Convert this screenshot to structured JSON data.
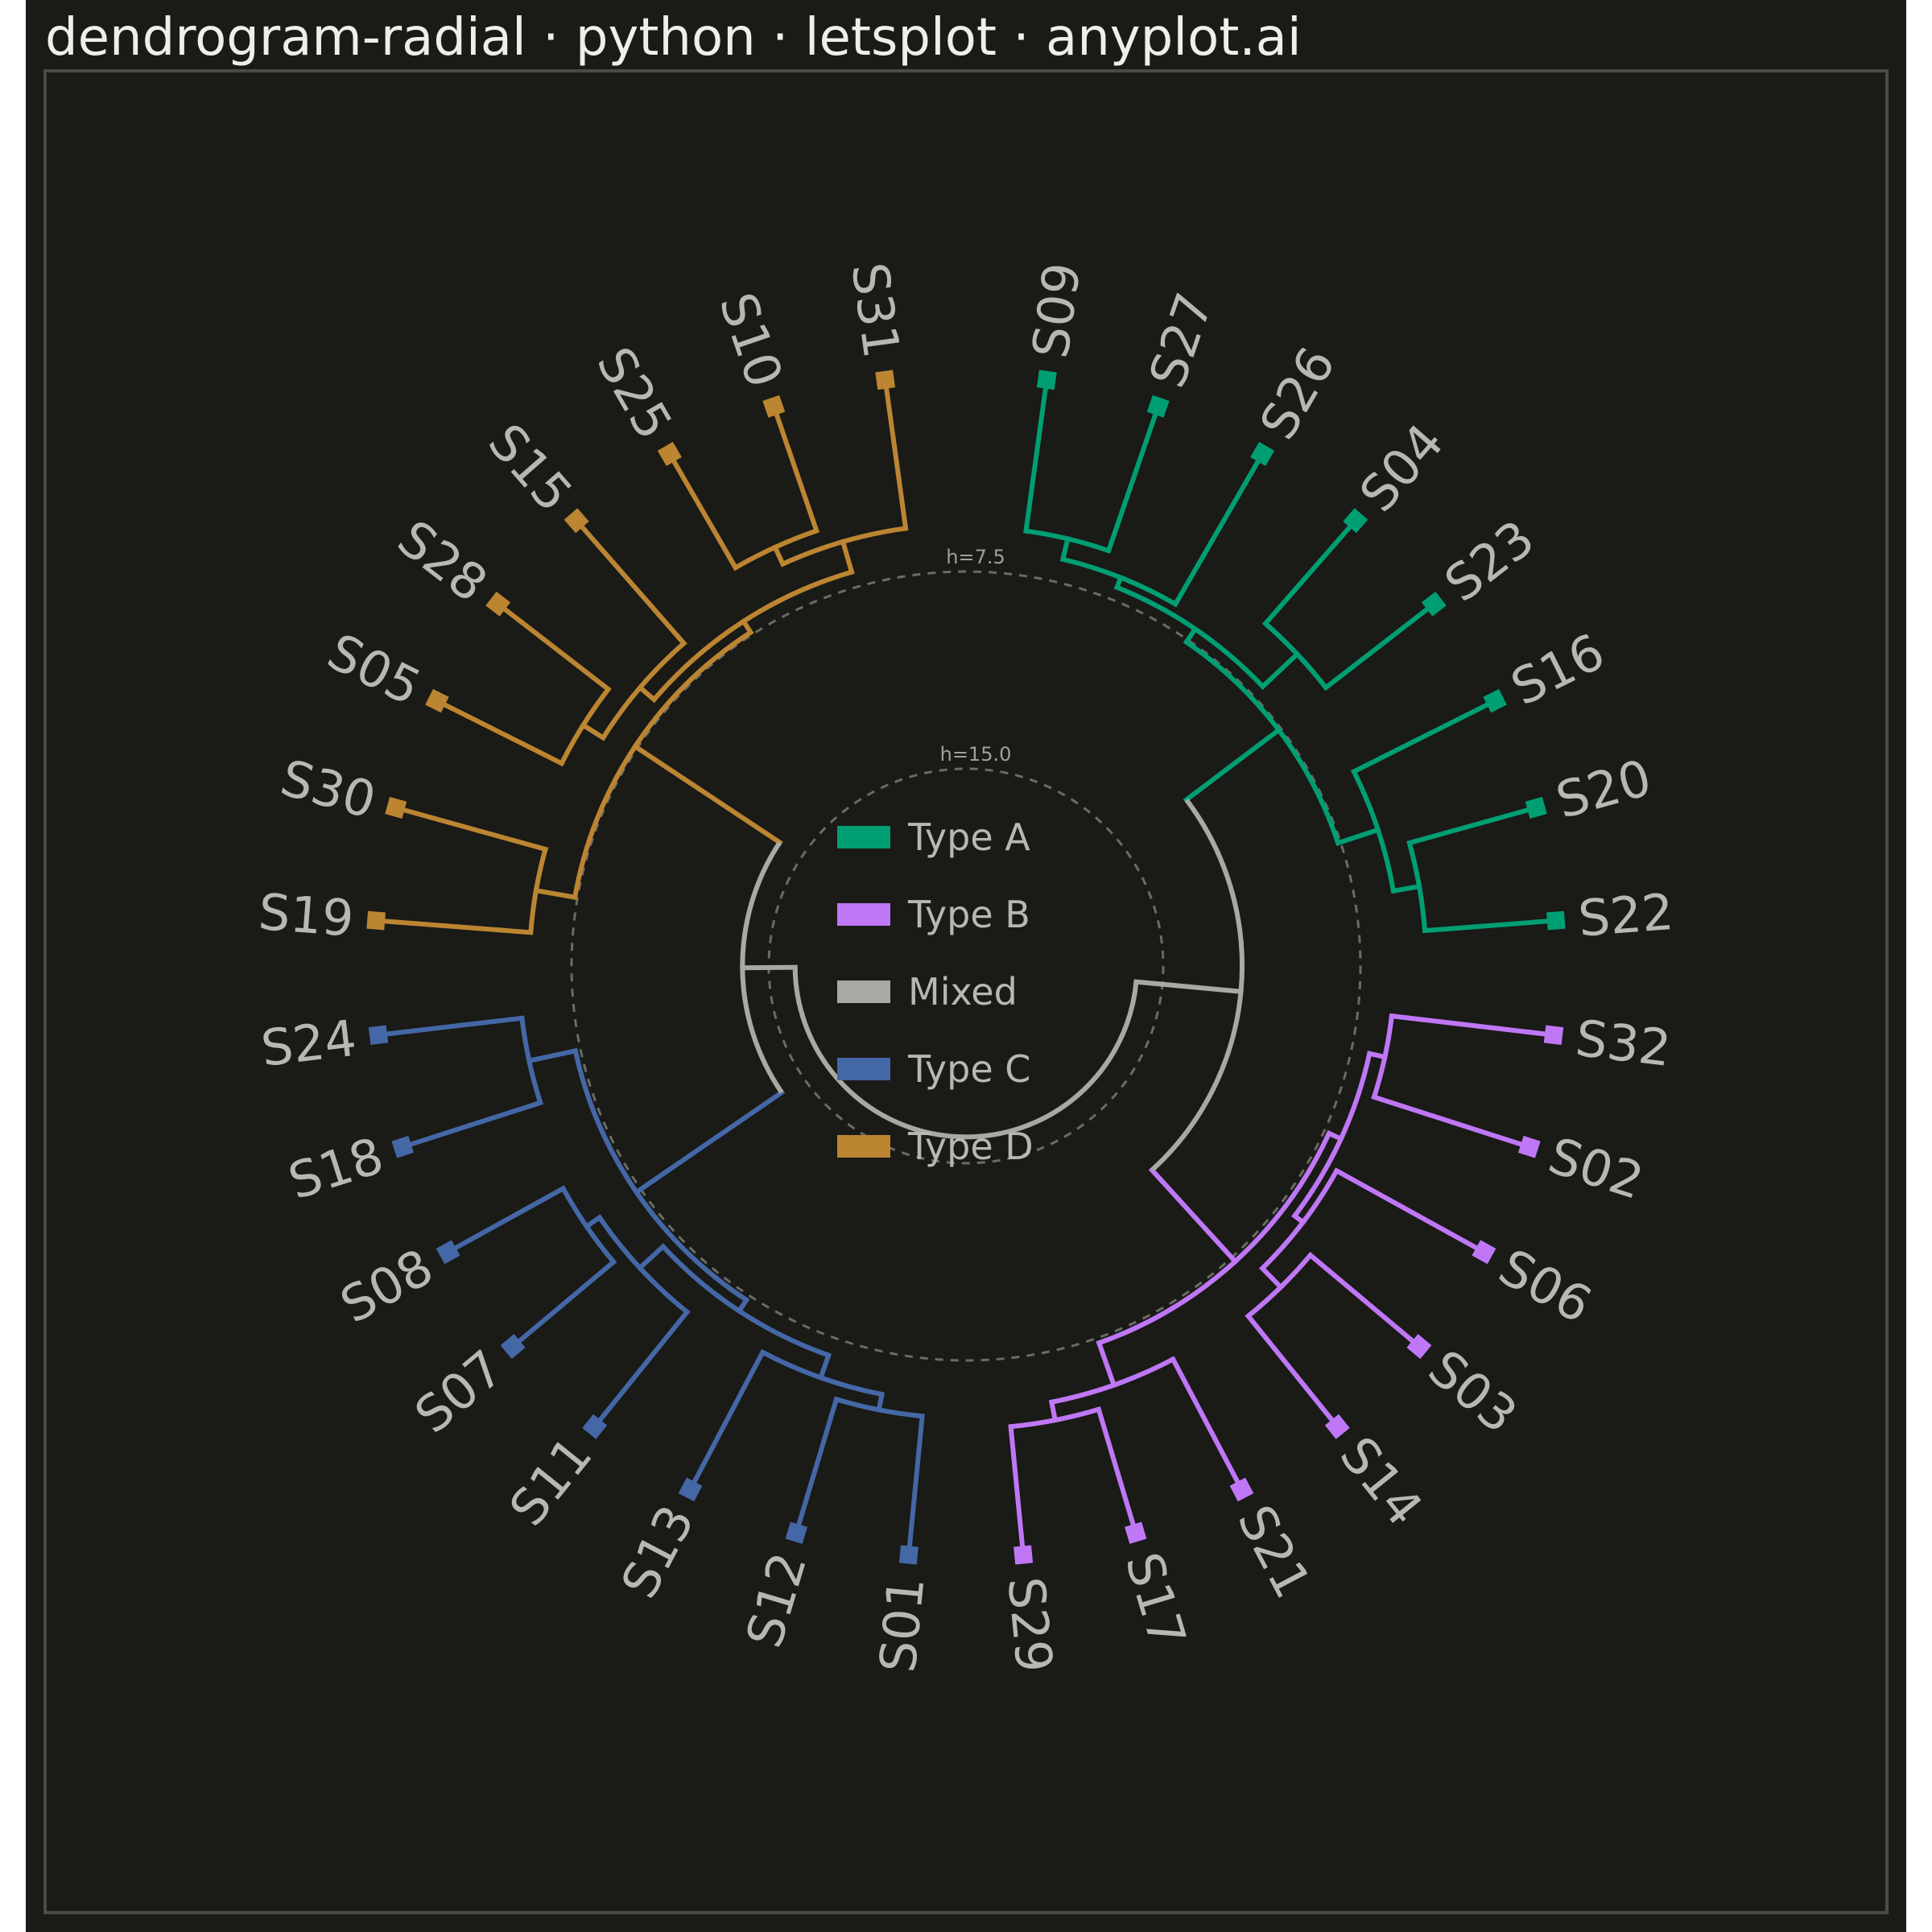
{
  "title": "dendrogram-radial · python · letsplot · anyplot.ai",
  "colors": {
    "background": "#1a1a17",
    "panel_border": "#4a4a46",
    "grid": "#6b6b66",
    "text": "#b8b8b0",
    "Type A": "#009e73",
    "Type B": "#bf77f6",
    "Mixed": "#a9a9a3",
    "Type C": "#4467a6",
    "Type D": "#bb8532"
  },
  "chart_data": {
    "type": "radial-dendrogram",
    "grid": true,
    "legend_position": "center",
    "ring_labels": [
      "h=7.5",
      "h=15.0"
    ],
    "rings": [
      7.5,
      15.0
    ],
    "max_height": 22.5,
    "legend": [
      {
        "name": "Type A"
      },
      {
        "name": "Type B"
      },
      {
        "name": "Mixed"
      },
      {
        "name": "Type C"
      },
      {
        "name": "Type D"
      }
    ],
    "leaves": [
      {
        "label": "S09",
        "group": "Type A"
      },
      {
        "label": "S27",
        "group": "Type A"
      },
      {
        "label": "S26",
        "group": "Type A"
      },
      {
        "label": "S04",
        "group": "Type A"
      },
      {
        "label": "S23",
        "group": "Type A"
      },
      {
        "label": "S16",
        "group": "Type A"
      },
      {
        "label": "S20",
        "group": "Type A"
      },
      {
        "label": "S22",
        "group": "Type A"
      },
      {
        "label": "S32",
        "group": "Type B"
      },
      {
        "label": "S02",
        "group": "Type B"
      },
      {
        "label": "S06",
        "group": "Type B"
      },
      {
        "label": "S03",
        "group": "Type B"
      },
      {
        "label": "S14",
        "group": "Type B"
      },
      {
        "label": "S21",
        "group": "Type B"
      },
      {
        "label": "S17",
        "group": "Type B"
      },
      {
        "label": "S29",
        "group": "Type B"
      },
      {
        "label": "S01",
        "group": "Type C"
      },
      {
        "label": "S12",
        "group": "Type C"
      },
      {
        "label": "S13",
        "group": "Type C"
      },
      {
        "label": "S11",
        "group": "Type C"
      },
      {
        "label": "S07",
        "group": "Type C"
      },
      {
        "label": "S08",
        "group": "Type C"
      },
      {
        "label": "S18",
        "group": "Type C"
      },
      {
        "label": "S24",
        "group": "Type C"
      },
      {
        "label": "S19",
        "group": "Type D"
      },
      {
        "label": "S30",
        "group": "Type D"
      },
      {
        "label": "S05",
        "group": "Type D"
      },
      {
        "label": "S28",
        "group": "Type D"
      },
      {
        "label": "S15",
        "group": "Type D"
      },
      {
        "label": "S25",
        "group": "Type D"
      },
      {
        "label": "S10",
        "group": "Type D"
      },
      {
        "label": "S31",
        "group": "Type D"
      }
    ],
    "merges": [
      {
        "id": "A1",
        "children": [
          "S09",
          "S27"
        ],
        "height": 5.8,
        "group": "Type A"
      },
      {
        "id": "A2",
        "children": [
          "A1",
          "S26"
        ],
        "height": 6.6,
        "group": "Type A"
      },
      {
        "id": "A3",
        "children": [
          "S04",
          "S23"
        ],
        "height": 5.2,
        "group": "Type A"
      },
      {
        "id": "A4",
        "children": [
          "A2",
          "A3"
        ],
        "height": 7.0,
        "group": "Type A"
      },
      {
        "id": "A5",
        "children": [
          "S20",
          "S22"
        ],
        "height": 5.0,
        "group": "Type A"
      },
      {
        "id": "A6",
        "children": [
          "S16",
          "A5"
        ],
        "height": 6.0,
        "group": "Type A"
      },
      {
        "id": "A7",
        "children": [
          "A4",
          "A6"
        ],
        "height": 7.6,
        "group": "Type A"
      },
      {
        "id": "B1",
        "children": [
          "S32",
          "S02"
        ],
        "height": 6.2,
        "group": "Type B"
      },
      {
        "id": "B2",
        "children": [
          "S03",
          "S14"
        ],
        "height": 5.4,
        "group": "Type B"
      },
      {
        "id": "B3",
        "children": [
          "S06",
          "B2"
        ],
        "height": 6.4,
        "group": "Type B"
      },
      {
        "id": "B4",
        "children": [
          "B1",
          "B3"
        ],
        "height": 6.8,
        "group": "Type B"
      },
      {
        "id": "B5",
        "children": [
          "S17",
          "S29"
        ],
        "height": 4.9,
        "group": "Type B"
      },
      {
        "id": "B6",
        "children": [
          "S21",
          "B5"
        ],
        "height": 5.6,
        "group": "Type B"
      },
      {
        "id": "B7",
        "children": [
          "B4",
          "B6"
        ],
        "height": 7.3,
        "group": "Type B"
      },
      {
        "id": "C1",
        "children": [
          "S01",
          "S12"
        ],
        "height": 5.3,
        "group": "Type C"
      },
      {
        "id": "C2",
        "children": [
          "C1",
          "S13"
        ],
        "height": 5.9,
        "group": "Type C"
      },
      {
        "id": "C3",
        "children": [
          "S07",
          "S08"
        ],
        "height": 5.0,
        "group": "Type C"
      },
      {
        "id": "C4",
        "children": [
          "S11",
          "C3"
        ],
        "height": 5.6,
        "group": "Type C"
      },
      {
        "id": "C5",
        "children": [
          "C2",
          "C4"
        ],
        "height": 6.8,
        "group": "Type C"
      },
      {
        "id": "C6",
        "children": [
          "S18",
          "S24"
        ],
        "height": 5.5,
        "group": "Type C"
      },
      {
        "id": "C7",
        "children": [
          "C5",
          "C6"
        ],
        "height": 7.3,
        "group": "Type C"
      },
      {
        "id": "D1",
        "children": [
          "S30",
          "S19"
        ],
        "height": 5.9,
        "group": "Type D"
      },
      {
        "id": "D2",
        "children": [
          "S05",
          "S28"
        ],
        "height": 5.3,
        "group": "Type D"
      },
      {
        "id": "D3",
        "children": [
          "D2",
          "S15"
        ],
        "height": 6.2,
        "group": "Type D"
      },
      {
        "id": "D4",
        "children": [
          "S25",
          "S10"
        ],
        "height": 5.0,
        "group": "Type D"
      },
      {
        "id": "D5",
        "children": [
          "D4",
          "S31"
        ],
        "height": 5.7,
        "group": "Type D"
      },
      {
        "id": "D6",
        "children": [
          "D3",
          "D5"
        ],
        "height": 6.9,
        "group": "Type D"
      },
      {
        "id": "D7",
        "children": [
          "D1",
          "D6"
        ],
        "height": 7.4,
        "group": "Type D"
      },
      {
        "id": "M1",
        "children": [
          "A7",
          "B7"
        ],
        "height": 12.0,
        "group": "Mixed"
      },
      {
        "id": "M2",
        "children": [
          "C7",
          "D7"
        ],
        "height": 14.0,
        "group": "Mixed"
      },
      {
        "id": "M3",
        "children": [
          "M1",
          "M2"
        ],
        "height": 16.0,
        "group": "Mixed"
      }
    ]
  }
}
